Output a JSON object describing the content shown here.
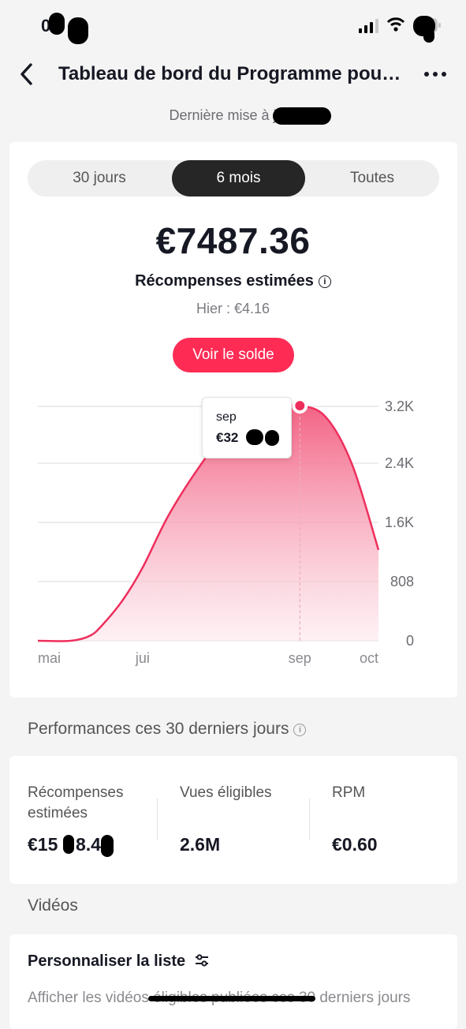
{
  "status_bar": {
    "time": "0"
  },
  "header": {
    "title": "Tableau de bord du Programme pou…",
    "last_update": "Dernière mise à jour"
  },
  "tabs": [
    {
      "label": "30 jours",
      "active": false
    },
    {
      "label": "6 mois",
      "active": true
    },
    {
      "label": "Toutes",
      "active": false
    }
  ],
  "summary": {
    "amount": "€7487.36",
    "label": "Récompenses estimées",
    "yesterday": "Hier : €4.16",
    "balance_button": "Voir le solde"
  },
  "chart_data": {
    "type": "area",
    "x": [
      "mai",
      "jui",
      "sep",
      "oct"
    ],
    "y_ticks": [
      "0",
      "808",
      "1.6K",
      "2.4K",
      "3.2K"
    ],
    "ylim": [
      0,
      3200
    ],
    "points": [
      {
        "month": 5.0,
        "value": 0
      },
      {
        "month": 5.5,
        "value": 0
      },
      {
        "month": 5.8,
        "value": 70
      },
      {
        "month": 6.0,
        "value": 230
      },
      {
        "month": 6.3,
        "value": 560
      },
      {
        "month": 6.6,
        "value": 1000
      },
      {
        "month": 7.0,
        "value": 1720
      },
      {
        "month": 7.5,
        "value": 2420
      },
      {
        "month": 8.0,
        "value": 2990
      },
      {
        "month": 8.5,
        "value": 3180
      },
      {
        "month": 9.0,
        "value": 3210
      },
      {
        "month": 9.4,
        "value": 3050
      },
      {
        "month": 9.8,
        "value": 2400
      },
      {
        "month": 10.2,
        "value": 1240
      }
    ],
    "highlight": {
      "month": 9.0,
      "label": "sep",
      "value_text": "€32"
    },
    "line_color": "#ee2f5c",
    "grid": true
  },
  "performance": {
    "title": "Performances ces 30 derniers jours",
    "metrics": [
      {
        "label": "Récompenses estimées",
        "value": "€15"
      },
      {
        "label": "Vues éligibles",
        "value": "2.6M"
      },
      {
        "label": "RPM",
        "value": "€0.60"
      }
    ]
  },
  "videos": {
    "title": "Vidéos",
    "customize": "Personnaliser la liste",
    "description": "Afficher les vidéos éligibles publiées ces 30 derniers jours"
  },
  "colors": {
    "accent": "#fe2c55",
    "active_tab": "#262626"
  },
  "icons": [
    "back-arrow-icon",
    "more-dots-icon",
    "info-icon",
    "sliders-icon",
    "signal-icon",
    "wifi-icon",
    "battery-icon"
  ]
}
